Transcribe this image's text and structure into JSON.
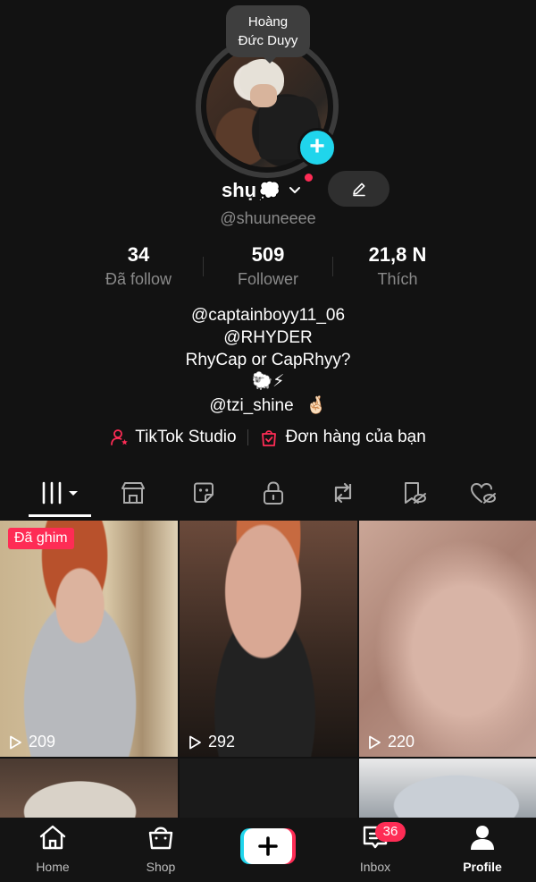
{
  "profile": {
    "tooltip_line1": "Hoàng",
    "tooltip_line2": "Đức Duyy",
    "display_name": "shụ",
    "name_emoji": "💭",
    "username": "@shuuneeee"
  },
  "stats": [
    {
      "value": "34",
      "label": "Đã follow"
    },
    {
      "value": "509",
      "label": "Follower"
    },
    {
      "value": "21,8 N",
      "label": "Thích"
    }
  ],
  "bio": {
    "line1": "@captainboyy11_06",
    "line2": "@RHYDER",
    "line3": "RhyCap or CapRhyy?",
    "line4": "🐑⚡",
    "line5_text": "@tzi_shine",
    "line5_emoji": "🤞🏻"
  },
  "links": {
    "studio": "TikTok Studio",
    "orders": "Đơn hàng của bạn"
  },
  "tabs": [
    "videos-grid",
    "shop",
    "stickers",
    "private",
    "reposts",
    "hidden",
    "liked"
  ],
  "videos": [
    {
      "views": "209",
      "pinned_label": "Đã ghim"
    },
    {
      "views": "292"
    },
    {
      "views": "220"
    }
  ],
  "nav": {
    "home": "Home",
    "shop": "Shop",
    "inbox": "Inbox",
    "inbox_badge": "36",
    "profile": "Profile"
  },
  "colors": {
    "accent_red": "#fe2c55",
    "accent_cyan": "#20d5ec",
    "background": "#121212"
  }
}
